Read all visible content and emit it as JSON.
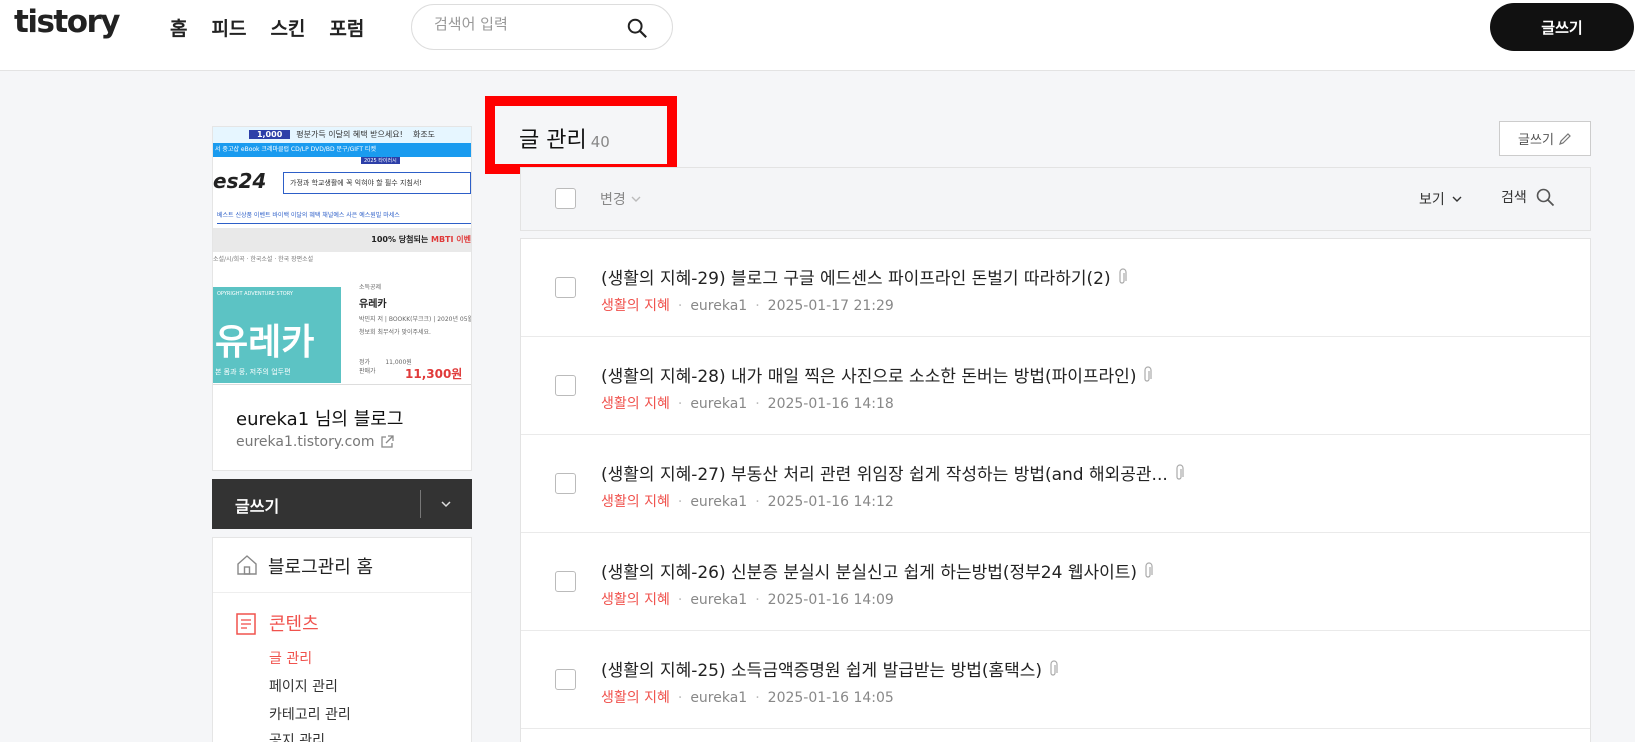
{
  "topbar": {
    "logo": "tistory",
    "nav": [
      "홈",
      "피드",
      "스킨",
      "포럼"
    ],
    "search_placeholder": "검색어 입력",
    "write_label": "글쓰기"
  },
  "sidebar": {
    "thumbnail": {
      "banner_price": "1,000",
      "banner_text": "평분가득 이달의 혜택 받으세요!",
      "banner_right": "화조도",
      "nav_text": "서 중고샵 eBook 크레마클럽 CD/LP DVD/BD 문구/GIFT 티켓",
      "nav_badge": "2025 타이러시",
      "logo": "es24",
      "search_text": "가정과 학교생활에 꼭 익혀야 할 필수 지침서!",
      "menu_text": "베스트 신상품 이벤트 바이백 이달의 혜택 채널예스 사은 예스원빌 마세스",
      "promo_text": "100% 당첨되는",
      "promo_highlight": "MBTI 이벤",
      "crumb_text": "소설/시/희곡 · 한국소설 · 한국 장편소설",
      "cover_small": "OPYRIGHT ADVENTURE STORY",
      "cover_title": "유레카",
      "cover_sub": "본 몸과 뭉, 저주의 업두편",
      "book_badge": "소득공제",
      "book_title": "유레카",
      "book_author": "박민지 저 | BOOKK(부크크) | 2020년 05월 10",
      "book_desc": "청보회 최무석가 맞이주세요.",
      "price_label": "정가",
      "price_value": "11,000원",
      "sale_label": "판매가",
      "sale_value": "11,300원"
    },
    "blog_name": "eureka1 님의 블로그",
    "blog_url": "eureka1.tistory.com",
    "write_label": "글쓰기",
    "menu_home": "블로그관리 홈",
    "menu_content": "콘텐츠",
    "sub_items": [
      "글 관리",
      "페이지 관리",
      "카테고리 관리",
      "공지 관리"
    ]
  },
  "main": {
    "title": "글 관리",
    "count": "40",
    "write_label": "글쓰기",
    "change_label": "변경",
    "view_label": "보기",
    "search_label": "검색",
    "posts": [
      {
        "title": "(생활의 지혜-29) 블로그 구글 에드센스 파이프라인 돈벌기 따라하기(2)",
        "category": "생활의 지혜",
        "author": "eureka1",
        "date": "2025-01-17 21:29"
      },
      {
        "title": "(생활의 지혜-28) 내가 매일 찍은 사진으로 소소한 돈버는 방법(파이프라인)",
        "category": "생활의 지혜",
        "author": "eureka1",
        "date": "2025-01-16 14:18"
      },
      {
        "title": "(생활의 지혜-27) 부동산 처리 관련 위임장 쉽게 작성하는 방법(and 해외공관...",
        "category": "생활의 지혜",
        "author": "eureka1",
        "date": "2025-01-16 14:12"
      },
      {
        "title": "(생활의 지혜-26) 신분증 분실시 분실신고 쉽게 하는방법(정부24 웹사이트)",
        "category": "생활의 지혜",
        "author": "eureka1",
        "date": "2025-01-16 14:09"
      },
      {
        "title": "(생활의 지혜-25) 소득금액증명원 쉽게 발급받는 방법(홈택스)",
        "category": "생활의 지혜",
        "author": "eureka1",
        "date": "2025-01-16 14:05"
      }
    ]
  },
  "colors": {
    "accent": "#f0524d",
    "highlight_box": "#ff0000",
    "dark_button": "#111111"
  }
}
